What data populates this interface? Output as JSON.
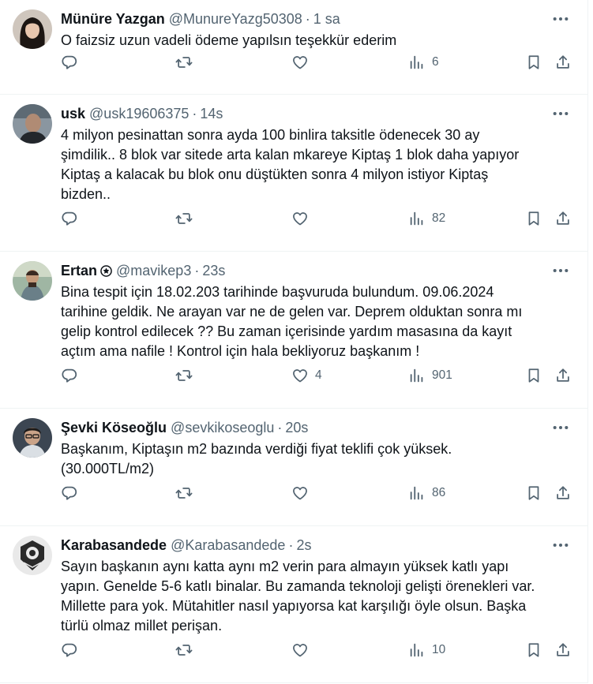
{
  "tweets": [
    {
      "name": "Münüre Yazgan",
      "handle": "@MunureYazg50308",
      "separator": "·",
      "time": "1 sa",
      "verified": false,
      "text": "O faizsiz uzun vadeli ödeme yapılsın teşekkür ederim",
      "views": "6",
      "likes": ""
    },
    {
      "name": "usk",
      "handle": "@usk19606375",
      "separator": "·",
      "time": "14s",
      "verified": false,
      "text": "4 milyon pesinattan sonra ayda 100 binlira taksitle ödenecek 30 ay\nşimdilik.. 8 blok var sitede arta kalan mkareye  Kiptaş 1 blok daha yapıyor\nKiptaş a kalacak bu blok onu düştükten sonra 4 milyon istiyor Kiptaş\nbizden..",
      "views": "82",
      "likes": ""
    },
    {
      "name": "Ertan",
      "handle": "@mavikep3",
      "separator": "·",
      "time": "23s",
      "verified": true,
      "text": "Bina tespit için 18.02.203 tarihinde başvuruda bulundum. 09.06.2024\ntarihine geldik. Ne arayan var ne de gelen var. Deprem olduktan sonra mı\ngelip kontrol edilecek ?? Bu zaman içerisinde yardım masasına da kayıt\naçtım ama nafile ! Kontrol için hala bekliyoruz başkanım !",
      "views": "901",
      "likes": "4"
    },
    {
      "name": "Şevki Köseoğlu",
      "handle": "@sevkikoseoglu",
      "separator": "·",
      "time": "20s",
      "verified": false,
      "text": "Başkanım, Kiptaşın m2 bazında verdiği fiyat teklifi çok yüksek.\n(30.000TL/m2)",
      "views": "86",
      "likes": ""
    },
    {
      "name": "Karabasandede",
      "handle": "@Karabasandede",
      "separator": "·",
      "time": "2s",
      "verified": false,
      "text": "Sayın başkanın aynı katta aynı m2 verin para almayın yüksek katlı yapı\nyapın. Genelde 5-6 katlı binalar. Bu zamanda teknoloji gelişti örenekleri var.\nMillette para yok. Mütahitler nasıl yapıyorsa kat karşılığı öyle olsun. Başka\ntürlü olmaz millet perişan.",
      "views": "10",
      "likes": ""
    }
  ],
  "icons": {
    "more": "more-icon",
    "reply": "reply-icon",
    "retweet": "retweet-icon",
    "like": "like-icon",
    "views": "views-icon",
    "bookmark": "bookmark-icon",
    "share": "share-icon",
    "verified": "verified-badge-icon"
  },
  "colors": {
    "text": "#0f1419",
    "secondary": "#536471",
    "border": "#eff3f4",
    "background": "#ffffff"
  }
}
